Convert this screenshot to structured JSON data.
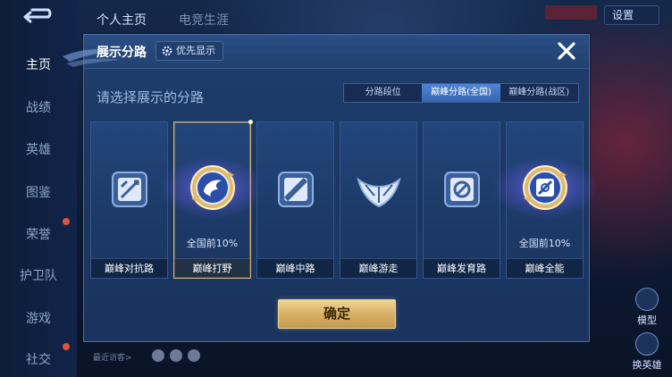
{
  "background": {
    "top_tabs": [
      "个人主页",
      "电竞生涯"
    ],
    "nav_items": [
      {
        "label": "主页",
        "active": true
      },
      {
        "label": "战绩",
        "active": false
      },
      {
        "label": "英雄",
        "active": false
      },
      {
        "label": "图鉴",
        "active": false
      },
      {
        "label": "荣誉",
        "active": false
      },
      {
        "label": "护卫队",
        "active": false
      },
      {
        "label": "游戏",
        "active": false
      },
      {
        "label": "社交",
        "active": false
      }
    ],
    "settings_label": "设置",
    "side_buttons": [
      "模型",
      "换英雄"
    ],
    "visitors_label": "最近访客>"
  },
  "dialog": {
    "title": "展示分路",
    "priority_label": "优先显示",
    "prompt": "请选择展示的分路",
    "segments": [
      {
        "label": "分路段位",
        "active": false
      },
      {
        "label": "巅峰分路(全国)",
        "active": true
      },
      {
        "label": "巅峰分路(战区)",
        "active": false
      }
    ],
    "cards": [
      {
        "label": "巅峰对抗路",
        "rank": "",
        "icon": "sword-shield-icon",
        "selected": false
      },
      {
        "label": "巅峰打野",
        "rank": "全国前10%",
        "icon": "jungle-emblem-icon",
        "selected": true
      },
      {
        "label": "巅峰中路",
        "rank": "",
        "icon": "slash-lane-icon",
        "selected": false
      },
      {
        "label": "巅峰游走",
        "rank": "",
        "icon": "wings-icon",
        "selected": false
      },
      {
        "label": "巅峰发育路",
        "rank": "",
        "icon": "target-icon",
        "selected": false
      },
      {
        "label": "巅峰全能",
        "rank": "全国前10%",
        "icon": "allround-emblem-icon",
        "selected": false
      }
    ],
    "confirm_label": "确定"
  },
  "colors": {
    "accent_gold": "#d8b06a",
    "segment_active": "#3f74c2",
    "panel": "#1b3764"
  }
}
